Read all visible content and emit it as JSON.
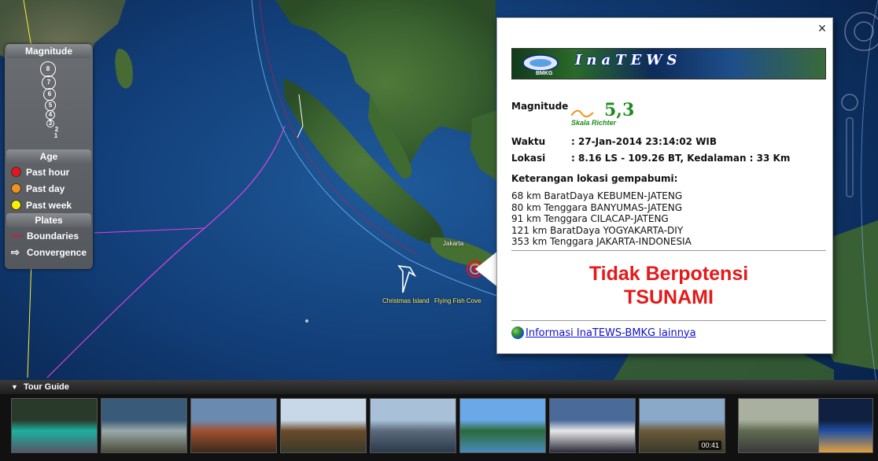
{
  "map": {
    "labels": {
      "jakarta": "Jakarta",
      "christmas_island": "Christmas Island",
      "flying_fish_cove": "Flying Fish Cove"
    }
  },
  "legend": {
    "magnitude_title": "Magnitude",
    "magnitude_scale": [
      "8",
      "7",
      "6",
      "5",
      "4",
      "3",
      "2",
      "1"
    ],
    "age_title": "Age",
    "age_items": [
      {
        "label": "Past hour",
        "color": "#e8141c"
      },
      {
        "label": "Past day",
        "color": "#f2921e"
      },
      {
        "label": "Past week",
        "color": "#ffee00"
      }
    ],
    "plates_title": "Plates",
    "plates_items": [
      {
        "label": "Boundaries",
        "color": "#d4183a"
      },
      {
        "label": "Convergence",
        "icon": "arrow-right-outline-icon"
      }
    ]
  },
  "balloon": {
    "close_label": "×",
    "banner": {
      "title": "InaTEWS",
      "subtitle": "BMKG"
    },
    "magnitude_label": "Magnitude",
    "magnitude_scale_label": "Skala Richter",
    "magnitude_value": "5,3",
    "time_label": "Waktu",
    "time_value": ": 27-Jan-2014 23:14:02 WIB",
    "location_label": "Lokasi",
    "location_value": ": 8.16 LS - 109.26 BT, Kedalaman : 33 Km",
    "location_desc_label": "Keterangan lokasi gempabumi:",
    "location_desc": [
      "68 km BaratDaya KEBUMEN-JATENG",
      "80 km Tenggara BANYUMAS-JATENG",
      "91 km Tenggara CILACAP-JATENG",
      "121 km BaratDaya YOGYAKARTA-DIY",
      "353 km Tenggara JAKARTA-INDONESIA"
    ],
    "tsunami_line1": "Tidak Berpotensi",
    "tsunami_line2": "TSUNAMI",
    "tsunami_color": "#e41a1a",
    "info_link": "Informasi InaTEWS-BMKG lainnya",
    "info_link_icon": "globe-icon"
  },
  "tour_guide": {
    "title": "Tour Guide",
    "toggle_icon": "double-chevron-down-icon",
    "thumbnails": [
      {
        "name": "crater-lake",
        "time": ""
      },
      {
        "name": "volcano-steam",
        "time": ""
      },
      {
        "name": "colonial-building",
        "time": ""
      },
      {
        "name": "traditional-house",
        "time": ""
      },
      {
        "name": "harbor-port",
        "time": ""
      },
      {
        "name": "lake-reflection",
        "time": ""
      },
      {
        "name": "grand-mosque",
        "time": ""
      },
      {
        "name": "mountain-road",
        "time": "00:41"
      },
      {
        "name": "aerial-island",
        "time": ""
      },
      {
        "name": "night-coast",
        "time": ""
      }
    ]
  },
  "colors": {
    "accent_red": "#e41a1a",
    "link_blue": "#1010cc",
    "magnitude_green": "#1e8a1e"
  }
}
